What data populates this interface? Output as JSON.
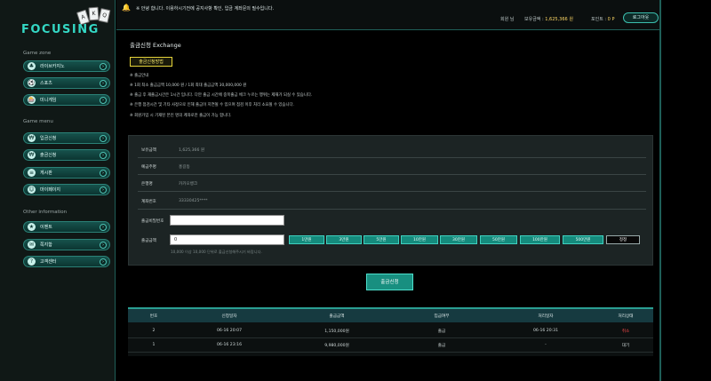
{
  "sidebar": {
    "logo_text": "FOCUSING",
    "card_glyphs": [
      "A",
      "K",
      "Q"
    ],
    "sections": [
      {
        "title": "Game zone",
        "items": [
          {
            "icon": "♣",
            "label": "라이브카지노"
          },
          {
            "icon": "⚽",
            "label": "스포츠"
          },
          {
            "icon": "🎰",
            "label": "미니게임"
          }
        ]
      },
      {
        "title": "Game menu",
        "items": [
          {
            "icon": "₩",
            "label": "입금신청"
          },
          {
            "icon": "₩",
            "label": "출금신청"
          },
          {
            "icon": "≡",
            "label": "게시판"
          },
          {
            "icon": "☺",
            "label": "마이페이지"
          }
        ]
      },
      {
        "title": "Other information",
        "items": [
          {
            "icon": "★",
            "label": "이벤트"
          },
          {
            "icon": "✉",
            "label": "쪽지함"
          },
          {
            "icon": "?",
            "label": "고객센터"
          }
        ]
      }
    ],
    "arrow": "›"
  },
  "topbar": {
    "notice_icon": "🔔",
    "notice": "※ 안녕 합니다. 이용하시기전에 공지사항 확인, 입금 계좌문의 필수입니다.",
    "user": "회원 님",
    "balance_label": "보유금액 :",
    "balance_value": "1,625,366 원",
    "point_label": "포인트 :",
    "point_value": "0 P",
    "logout": "로그아웃"
  },
  "page": {
    "title": "출금신청 Exchange",
    "tab": "출금신청방법",
    "info": [
      "※ 출금안내",
      "※ 1회 최소 출금금액 10,000 원 / 1회 최대 출금금액 30,000,000 원",
      "※ 출금 후 재출금시간은 1시간 입니다. 다만 출금 시간에 중복출금 체크 누르는 행위는 제재가 되실 수 있습니다.",
      "※ 은행 점검시간 및 기타 사정으로 인해 출금이 지연될 수 있으며 점검 이후 처리 소요될 수 있습니다.",
      "※ 회원가입 시 기재된 본인 명의 계좌로만 출금이 가능 합니다."
    ],
    "form": {
      "rows": [
        {
          "label": "보유금액",
          "value": "1,625,366 원"
        },
        {
          "label": "예금주명",
          "value": "홍길동"
        },
        {
          "label": "은행명",
          "value": "카카오뱅크"
        },
        {
          "label": "계좌번호",
          "value": "33330425****"
        }
      ],
      "password_label": "출금비밀번호",
      "amount_label": "출금금액",
      "amount_value": "0",
      "chips": [
        "1만원",
        "3만원",
        "5만원",
        "10만원",
        "30만원",
        "50만원",
        "100만원",
        "500만원"
      ],
      "reset": "정정",
      "hint": "10,000 이상 10,000 단위로 출금신청해주시기 바랍니다."
    },
    "submit": "출금신청"
  },
  "table": {
    "headers": [
      "번호",
      "신청일자",
      "출금금액",
      "입금여부",
      "처리일자",
      "처리상태"
    ],
    "rows": [
      {
        "cells": [
          "2",
          "06-16 20:07",
          "1,150,000원",
          "출금",
          "06-16 20:31",
          "취소"
        ],
        "status_color": "#ff4b4b"
      },
      {
        "cells": [
          "1",
          "06-16 23:16",
          "9,980,000원",
          "출금",
          "-",
          "대기"
        ],
        "status_color": ""
      }
    ]
  }
}
